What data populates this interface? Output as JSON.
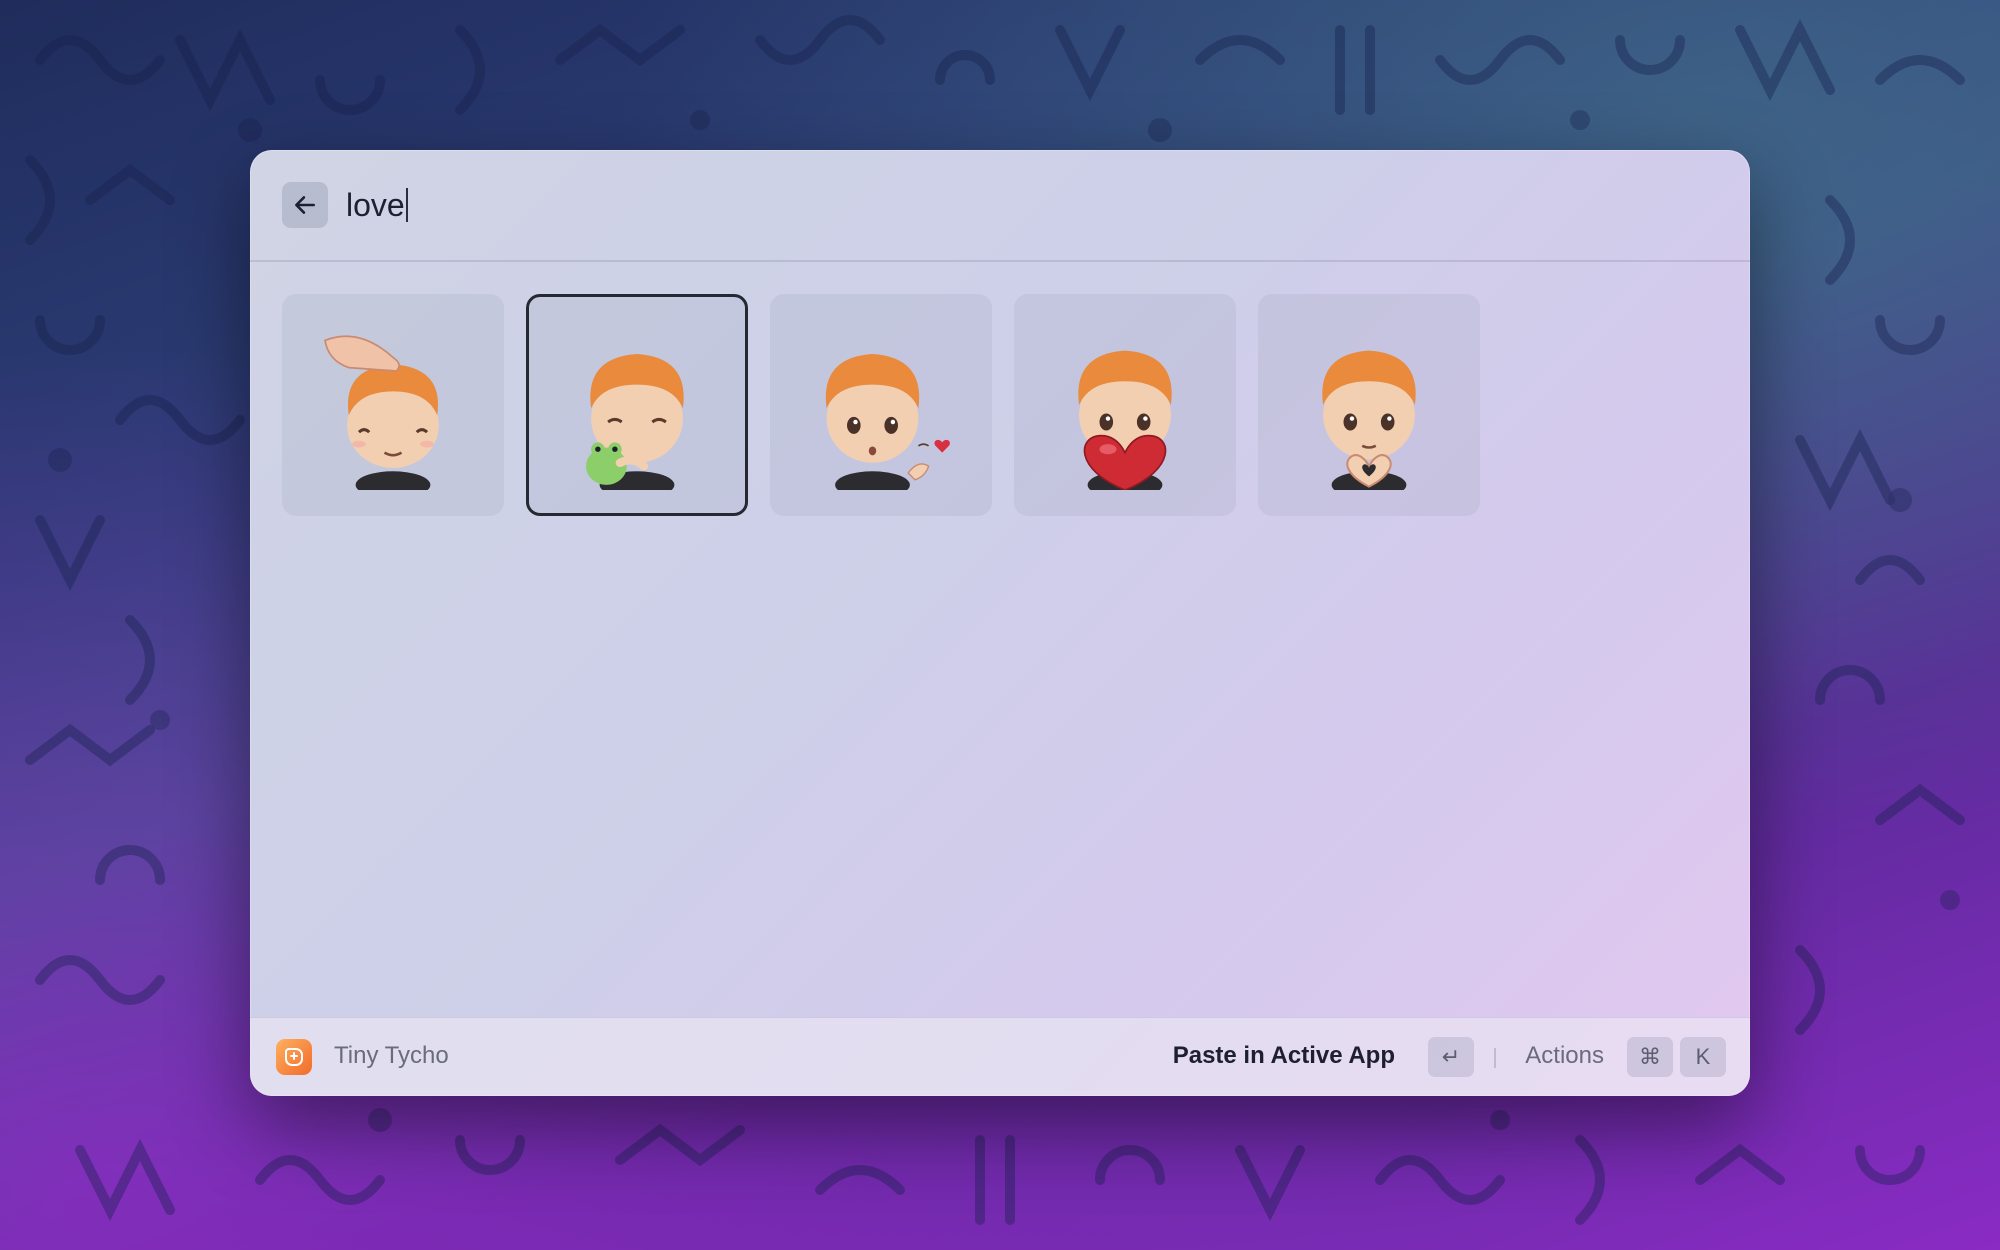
{
  "search": {
    "query": "love"
  },
  "stickers": [
    {
      "name": "head-pat-sticker"
    },
    {
      "name": "frog-hug-sticker",
      "selected": true
    },
    {
      "name": "blow-kiss-sticker"
    },
    {
      "name": "heart-hold-sticker"
    },
    {
      "name": "heart-hands-sticker"
    }
  ],
  "footer": {
    "app_name": "Tiny Tycho",
    "primary_action": "Paste in Active App",
    "enter_key": "↵",
    "actions_label": "Actions",
    "cmd_key": "⌘",
    "k_key": "K"
  },
  "colors": {
    "accent": "#f26b2a",
    "selection_border": "#262833"
  }
}
